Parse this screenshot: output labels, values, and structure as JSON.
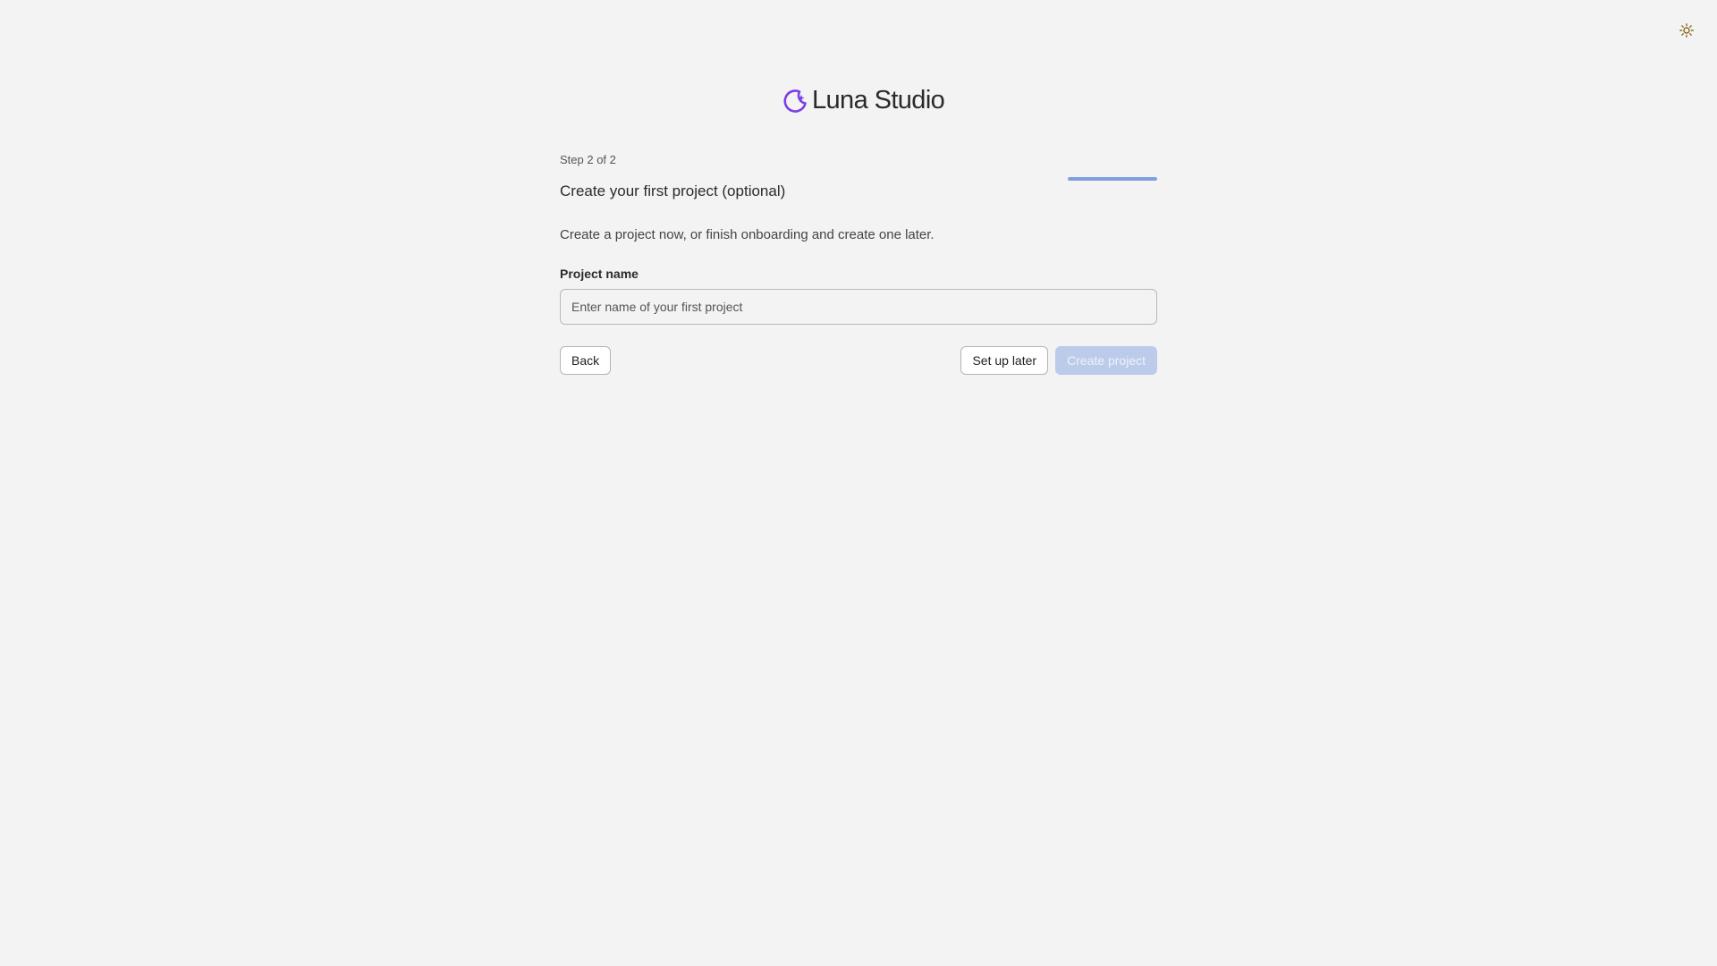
{
  "header": {
    "theme_toggle_icon": "sun-icon",
    "theme_icon_color": "#8a6a1e"
  },
  "brand": {
    "logo_icon": "moon-sparkle-icon",
    "logo_color": "#7b3fe4",
    "name": "Luna Studio"
  },
  "onboarding": {
    "step_label": "Step 2 of 2",
    "progress": 1.0,
    "progress_color": "#7f9fe0",
    "title": "Create your first project (optional)",
    "description": "Create a project now, or finish onboarding and create one later.",
    "field": {
      "label": "Project name",
      "value": "",
      "placeholder": "Enter name of your first project"
    },
    "buttons": {
      "back_label": "Back",
      "later_label": "Set up later",
      "create_label": "Create project",
      "create_disabled": true
    }
  }
}
